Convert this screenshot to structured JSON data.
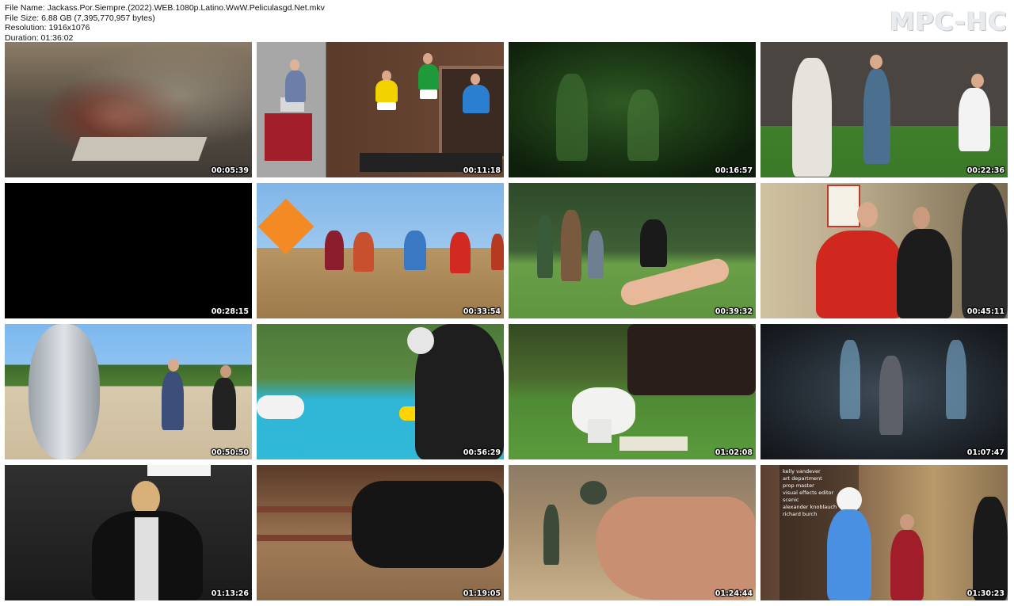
{
  "file_info": {
    "name_line": "File Name: Jackass.Por.Siempre.(2022).WEB.1080p.Latino.WwW.Peliculasgd.Net.mkv",
    "size_line": "File Size: 6.88 GB (7,395,770,957 bytes)",
    "resolution_line": "Resolution: 1916x1076",
    "duration_line": "Duration: 01:36:02"
  },
  "logo": "MPC-HC",
  "thumbnails": [
    {
      "timestamp": "00:05:39",
      "scene": "dusty miniature wreckage"
    },
    {
      "timestamp": "00:11:18",
      "scene": "men in underwear at fireplace"
    },
    {
      "timestamp": "00:16:57",
      "scene": "night vision green"
    },
    {
      "timestamp": "00:22:36",
      "scene": "beekeeper suit outdoors"
    },
    {
      "timestamp": "00:28:15",
      "scene": "black frame"
    },
    {
      "timestamp": "00:33:54",
      "scene": "group on hillside with kite"
    },
    {
      "timestamp": "00:39:32",
      "scene": "man on grass lawn"
    },
    {
      "timestamp": "00:45:11",
      "scene": "men by safety sign"
    },
    {
      "timestamp": "00:50:50",
      "scene": "silver inflatable suit in arena"
    },
    {
      "timestamp": "00:56:29",
      "scene": "pool stunt"
    },
    {
      "timestamp": "01:02:08",
      "scene": "toilet on lawn"
    },
    {
      "timestamp": "01:07:47",
      "scene": "dark blue figures"
    },
    {
      "timestamp": "01:13:26",
      "scene": "man in black jacket"
    },
    {
      "timestamp": "01:19:05",
      "scene": "bull in pen"
    },
    {
      "timestamp": "01:24:44",
      "scene": "desert helmet"
    },
    {
      "timestamp": "01:30:23",
      "scene": "football player credits"
    }
  ],
  "credits_text": [
    "kelly vandever",
    "art department",
    "prop master",
    "visual effects editor",
    "scenic",
    "alexander knoblauch",
    "richard burch"
  ]
}
